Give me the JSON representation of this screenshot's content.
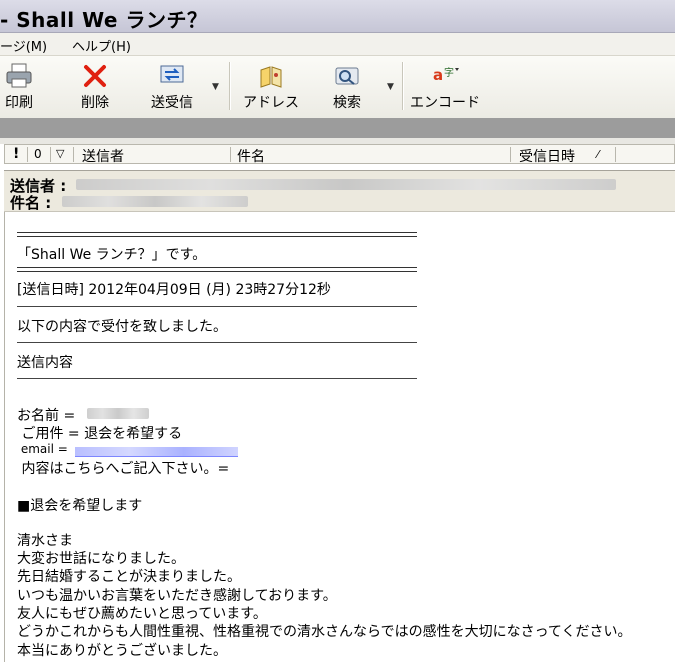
{
  "window": {
    "title": "- Shall We ランチ？"
  },
  "menu": {
    "items": [
      "ージ(M)",
      "ヘルプ(H)"
    ]
  },
  "toolbar": {
    "print": "印刷",
    "delete": "削除",
    "send_receive": "送受信",
    "address": "アドレス",
    "search": "検索",
    "encode": "エンコード"
  },
  "list_columns": {
    "flag": "!",
    "attach": "0",
    "mark": "▽",
    "sender": "送信者",
    "subject": "件名",
    "received": "受信日時",
    "sort_mark": "⁄"
  },
  "message_header": {
    "from_label": "送信者 :",
    "subject_label": "件名 :"
  },
  "body": {
    "rule_double": "==========================================",
    "rule_single": "------------------------------------------------------------------------",
    "form_title": "「Shall We ランチ？」です。",
    "sent_datetime": "[送信日時] 2012年04月09日 (月) 23時27分12秒",
    "received_note": "以下の内容で受付を致しました。",
    "sent_content": "送信内容",
    "name_field": "お名前 =",
    "request_field": " ご用件 = 退会を希望する",
    "email_field": " email =",
    "content_field": " 内容はこちらへご記入下さい。=",
    "withdraw": "■退会を希望します",
    "msg_lines": [
      "清水さま",
      "大変お世話になりました。",
      "先日結婚することが決まりました。",
      "いつも温かいお言葉をいただき感謝しております。",
      "友人にもぜひ薦めたいと思っています。",
      "どうかこれからも人間性重視、性格重視での清水さんならではの感性を大切になさってください。",
      "本当にありがとうございました。"
    ]
  }
}
